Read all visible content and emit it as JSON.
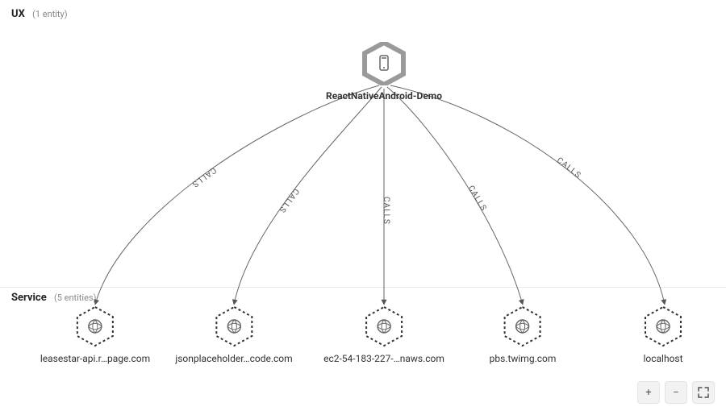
{
  "sections": {
    "ux": {
      "title": "UX",
      "count_label": "(1 entity)"
    },
    "service": {
      "title": "Service",
      "count_label": "(5 entities)"
    }
  },
  "root_node": {
    "label": "ReactNativeAndroid-Demo",
    "icon": "mobile-icon"
  },
  "services": [
    {
      "label": "leasestar-api.r…page.com"
    },
    {
      "label": "jsonplaceholder…code.com"
    },
    {
      "label": "ec2-54-183-227-…naws.com"
    },
    {
      "label": "pbs.twimg.com"
    },
    {
      "label": "localhost"
    }
  ],
  "edge_label": "CALLS",
  "controls": {
    "zoom_in": "+",
    "zoom_out": "−"
  }
}
